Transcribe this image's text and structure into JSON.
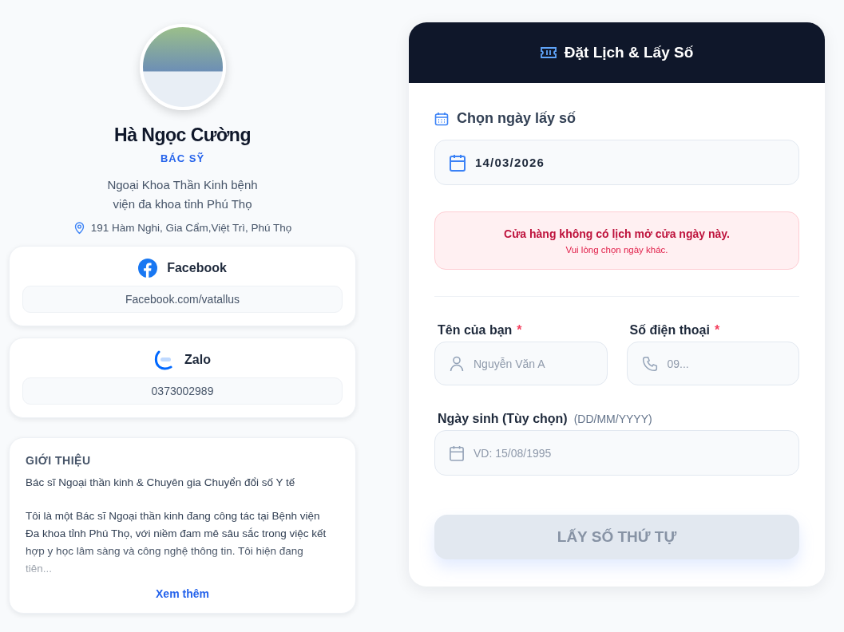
{
  "profile": {
    "name": "Hà Ngọc Cường",
    "role": "BÁC SỸ",
    "specialty": "Ngoại Khoa Thần Kinh bệnh viện đa khoa tỉnh Phú Thọ",
    "address": "191 Hàm Nghi, Gia Cẩm,Việt Trì, Phú Thọ"
  },
  "contacts": [
    {
      "kind": "facebook",
      "label": "Facebook",
      "value": "Facebook.com/vatallus"
    },
    {
      "kind": "zalo",
      "label": "Zalo",
      "value": "0373002989"
    }
  ],
  "intro": {
    "heading": "GIỚI THIỆU",
    "tagline": "Bác sĩ Ngoại thần kinh & Chuyên gia Chuyển đổi số Y tế",
    "body": "Tôi là một Bác sĩ Ngoại thần kinh đang công tác tại Bệnh viện Đa khoa tỉnh Phú Thọ, với niềm đam mê sâu sắc trong việc kết hợp y học lâm sàng và công nghệ thông tin. Tôi hiện đang tiên...",
    "more_link": "Xem thêm"
  },
  "booking": {
    "title": "Đặt Lịch & Lấy Số",
    "date_label": "Chọn ngày lấy số",
    "date_value": "14/03/2026",
    "alert": {
      "title": "Cửa hàng không có lịch mở cửa ngày này.",
      "message": "Vui lòng chọn ngày khác."
    },
    "fields": [
      {
        "kind": "name",
        "label": "Tên của bạn",
        "required_mark": "*",
        "placeholder": "Nguyễn Văn A"
      },
      {
        "kind": "phone",
        "label": "Số điện thoại",
        "required_mark": "*",
        "placeholder": "09..."
      },
      {
        "kind": "birthday",
        "label": "Ngày sinh (Tùy chọn)",
        "hint": "(DD/MM/YYYY)",
        "placeholder": "VD: 15/08/1995"
      }
    ],
    "submit": {
      "label": "LẤY SỐ THỨ TỰ",
      "disabled": true
    }
  }
}
